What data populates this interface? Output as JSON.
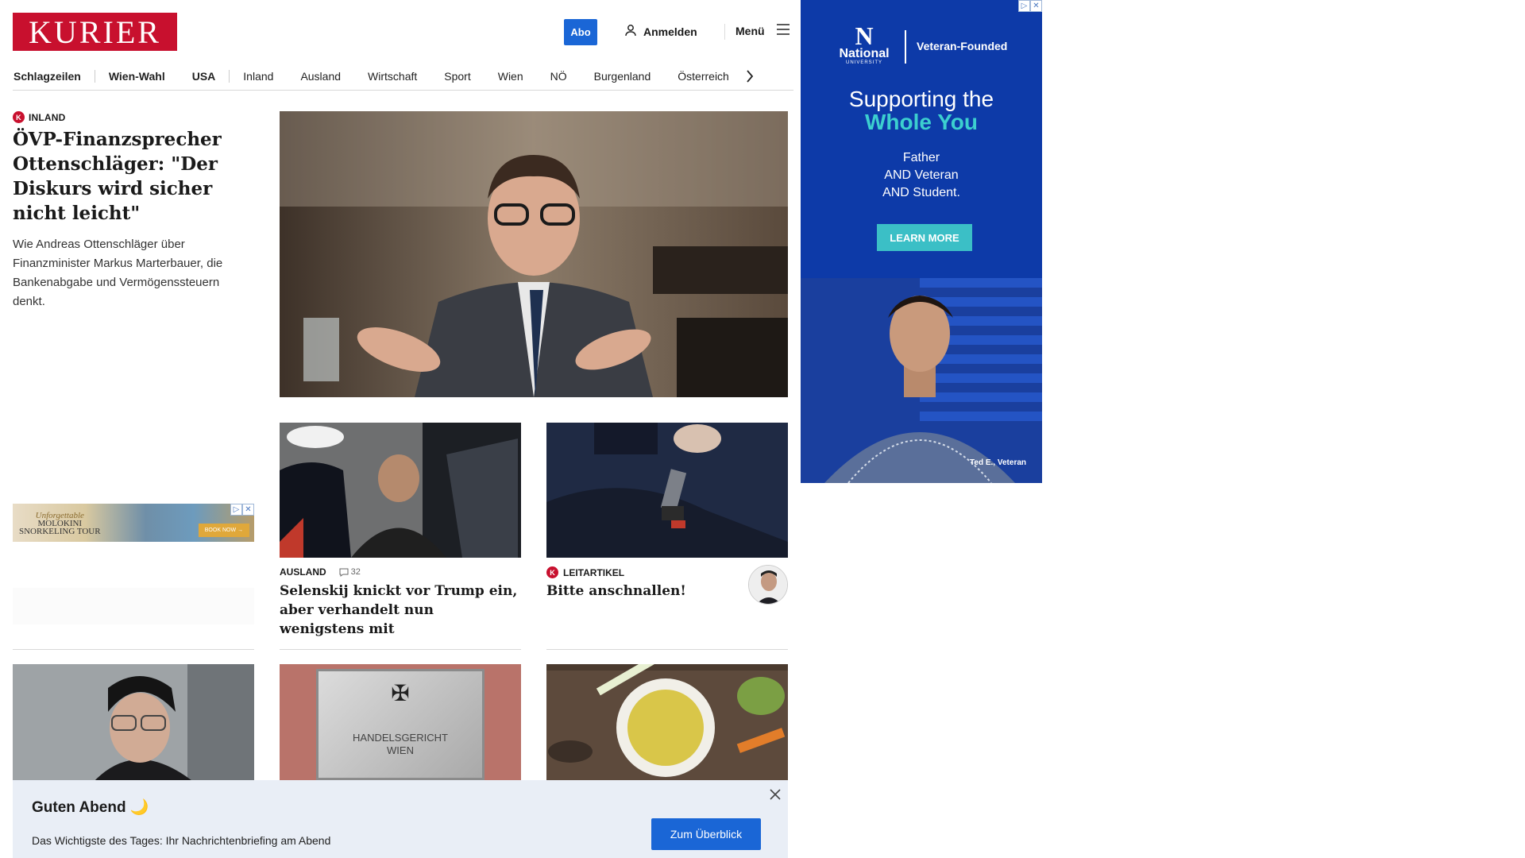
{
  "header": {
    "logo": "KURIER",
    "abo_label": "Abo",
    "login_label": "Anmelden",
    "menu_label": "Menü"
  },
  "nav": {
    "items": [
      "Schlagzeilen",
      "Wien-Wahl",
      "USA",
      "Inland",
      "Ausland",
      "Wirtschaft",
      "Sport",
      "Wien",
      "NÖ",
      "Burgenland",
      "Österreich"
    ]
  },
  "lead": {
    "category": "INLAND",
    "title": "ÖVP-Finanzsprecher Ottenschläger: \"Der Diskurs wird sicher nicht leicht\"",
    "teaser": "Wie Andreas Ottenschläger über Finanzminister Markus Marterbauer, die Bankenabgabe und Vermögenssteuern denkt."
  },
  "mini_ad": {
    "script": "Unforgettable",
    "line1": "MOLOKINI",
    "line2": "SNORKELING TOUR",
    "button": "BOOK NOW →"
  },
  "cards": [
    {
      "category": "AUSLAND",
      "comments": "32",
      "title": "Selenskij knickt vor Trump ein, aber verhandelt nun wenigstens mit"
    },
    {
      "category": "LEITARTIKEL",
      "title": "Bitte anschnallen!"
    }
  ],
  "thumbs": {
    "sign_line1": "HANDELSGERICHT",
    "sign_line2": "WIEN"
  },
  "briefing": {
    "title": "Guten Abend",
    "moon": "🌙",
    "text": "Das Wichtigste des Tages: Ihr Nachrichtenbriefing am Abend",
    "button": "Zum Überblick"
  },
  "side_ad": {
    "logo_name": "National",
    "logo_sub": "UNIVERSITY",
    "tagline": "Veteran-Founded",
    "headline_1": "Supporting the",
    "headline_2": "Whole You",
    "body_1": "Father",
    "body_2": "AND Veteran",
    "body_3": "AND Student.",
    "cta": "LEARN MORE",
    "caption": "Ted E., Veteran"
  }
}
